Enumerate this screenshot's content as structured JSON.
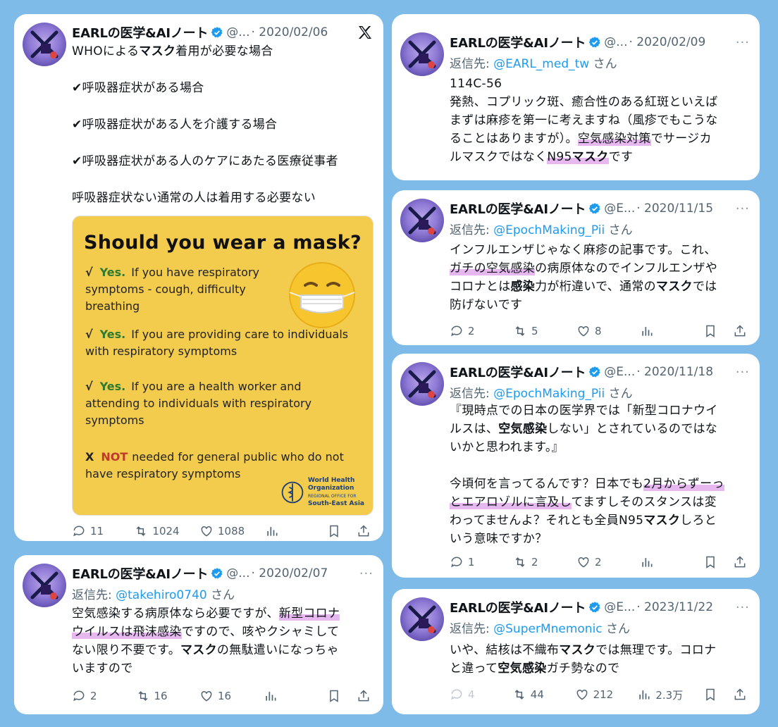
{
  "colors": {
    "background": "#7fbbe8",
    "highlight": "#e7b8f0",
    "mention": "#1d9bf0",
    "verified": "#1d9bf0",
    "muted": "#536471"
  },
  "icons": [
    "verified-badge-icon",
    "x-logo-icon",
    "more-icon",
    "reply-icon",
    "retweet-icon",
    "like-icon",
    "views-icon",
    "bookmark-icon",
    "share-icon"
  ],
  "tweets": [
    {
      "name": "EARLの医学&AIノート",
      "handle": "@...",
      "date": "· 2020/02/06",
      "lines": [
        [
          {
            "t": "WHOによる"
          },
          {
            "t": "マスク",
            "b": true
          },
          {
            "t": "着用が必要な場合"
          }
        ],
        [
          {
            "t": ""
          }
        ],
        [
          {
            "t": "✔呼吸器症状がある場合"
          }
        ],
        [
          {
            "t": ""
          }
        ],
        [
          {
            "t": "✔呼吸器症状がある人を介護する場合"
          }
        ],
        [
          {
            "t": ""
          }
        ],
        [
          {
            "t": "✔呼吸器症状がある人のケアにあたる医療従事者"
          }
        ],
        [
          {
            "t": ""
          }
        ],
        [
          {
            "t": "呼吸器症状ない通常の人は着用する必要ない"
          }
        ]
      ],
      "poster": {
        "title": "Should you wear a mask?",
        "check": "√",
        "yes": "Yes.",
        "row1": "If you have respiratory symptoms - cough, difficulty breathing",
        "row2": "If you are providing care to individuals with respiratory symptoms",
        "row3": "If you are a health worker and attending to individuals with respiratory symptoms",
        "x": "X",
        "not": "NOT",
        "row4": "needed for general public who do not have respiratory symptoms",
        "org1": "World Health",
        "org2": "Organization",
        "org3": "REGIONAL OFFICE FOR",
        "org4": "South-East Asia"
      },
      "stats": {
        "replies": "11",
        "retweets": "1024",
        "likes": "1088"
      }
    },
    {
      "name": "EARLの医学&AIノート",
      "handle": "@...",
      "date": "· 2020/02/07",
      "reply_prefix": "返信先: ",
      "reply_to": "@takehiro0740",
      "reply_suffix": " さん",
      "lines": [
        [
          {
            "t": "空気感染する病原体なら必要ですが、"
          },
          {
            "t": "新型コロナ",
            "h": true
          }
        ],
        [
          {
            "t": "ウイルスは飛沫感染",
            "h": true
          },
          {
            "t": "ですので、咳やクシャミして"
          }
        ],
        [
          {
            "t": "ない限り不要です。"
          },
          {
            "t": "マスク",
            "b": true
          },
          {
            "t": "の無駄遣いになっちゃ"
          }
        ],
        [
          {
            "t": "いますので"
          }
        ]
      ],
      "stats": {
        "replies": "2",
        "retweets": "16",
        "likes": "16"
      }
    },
    {
      "name": "EARLの医学&AIノート",
      "handle": "@...",
      "date": "· 2020/02/09",
      "reply_prefix": "返信先: ",
      "reply_to": "@EARL_med_tw",
      "reply_suffix": " さん",
      "lines": [
        [
          {
            "t": "114C-56"
          }
        ],
        [
          {
            "t": "発熱、コプリック斑、癒合性のある紅斑といえば"
          }
        ],
        [
          {
            "t": "まずは麻疹を第一に考えますね（風疹でもこうな"
          }
        ],
        [
          {
            "t": "ることはありますが）。"
          },
          {
            "t": "空気感染対策",
            "h": true
          },
          {
            "t": "でサージカ"
          }
        ],
        [
          {
            "t": "ルマスクではなく"
          },
          {
            "t": "N95",
            "h": true
          },
          {
            "t": "マスク",
            "h": true,
            "b": true
          },
          {
            "t": "です"
          }
        ]
      ]
    },
    {
      "name": "EARLの医学&AIノート",
      "handle": "@E...",
      "date": "· 2020/11/15",
      "reply_prefix": "返信先: ",
      "reply_to": "@EpochMaking_Pii",
      "reply_suffix": " さん",
      "lines": [
        [
          {
            "t": "インフルエンザじゃなく麻疹の記事です。これ、"
          }
        ],
        [
          {
            "t": "ガチの空気感染",
            "h": true
          },
          {
            "t": "の病原体なのでインフルエンザや"
          }
        ],
        [
          {
            "t": "コロナとは"
          },
          {
            "t": "感染",
            "b": true
          },
          {
            "t": "力が桁違いで、通常の"
          },
          {
            "t": "マスク",
            "b": true
          },
          {
            "t": "では"
          }
        ],
        [
          {
            "t": "防げないです"
          }
        ]
      ],
      "stats": {
        "replies": "2",
        "retweets": "5",
        "likes": "8"
      }
    },
    {
      "name": "EARLの医学&AIノート",
      "handle": "@E...",
      "date": "· 2020/11/18",
      "reply_prefix": "返信先: ",
      "reply_to": "@EpochMaking_Pii",
      "reply_suffix": " さん",
      "lines": [
        [
          {
            "t": "『現時点での日本の医学界では「新型コロナウイ"
          }
        ],
        [
          {
            "t": "ルスは、"
          },
          {
            "t": "空気感染",
            "b": true
          },
          {
            "t": "しない」とされているのではな"
          }
        ],
        [
          {
            "t": "いかと思われます。』"
          }
        ],
        [
          {
            "t": ""
          }
        ],
        [
          {
            "t": "今頃何を言ってるんです？日本でも"
          },
          {
            "t": "2月からずーっ",
            "h": true
          }
        ],
        [
          {
            "t": "とエアロゾルに言及し",
            "h": true
          },
          {
            "t": "てますしそのスタンスは変"
          }
        ],
        [
          {
            "t": "わってませんよ？それとも全員N95"
          },
          {
            "t": "マスク",
            "b": true
          },
          {
            "t": "しろと"
          }
        ],
        [
          {
            "t": "いう意味ですか？"
          }
        ]
      ],
      "stats": {
        "replies": "1",
        "retweets": "2",
        "likes": "2"
      }
    },
    {
      "name": "EARLの医学&AIノート",
      "handle": "@E...",
      "date": "· 2023/11/22",
      "reply_prefix": "返信先: ",
      "reply_to": "@SuperMnemonic",
      "reply_suffix": " さん",
      "lines": [
        [
          {
            "t": "いや、結核は不織布"
          },
          {
            "t": "マスク",
            "b": true
          },
          {
            "t": "では無理です。コロナ"
          }
        ],
        [
          {
            "t": "と違って"
          },
          {
            "t": "空気感染",
            "b": true
          },
          {
            "t": "ガチ勢なので"
          }
        ]
      ],
      "stats": {
        "replies": "4",
        "retweets": "44",
        "likes": "212",
        "views": "2.3万"
      }
    }
  ]
}
